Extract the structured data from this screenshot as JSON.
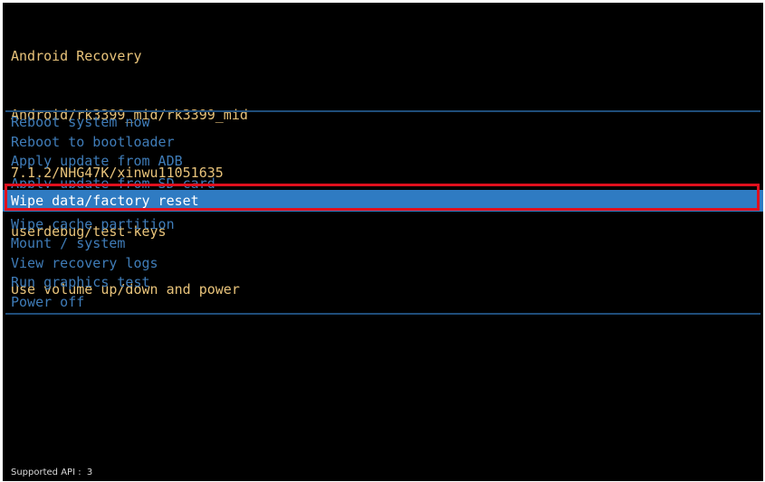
{
  "header": {
    "title": "Android Recovery",
    "device": "Android/rk3399_mid/rk3399_mid",
    "build": "7.1.2/NHG47K/xinwu11051635",
    "build_type": "userdebug/test-keys",
    "instructions": "Use volume up/down and power"
  },
  "menu": {
    "items": [
      {
        "label": "Reboot system now"
      },
      {
        "label": "Reboot to bootloader"
      },
      {
        "label": "Apply update from ADB"
      },
      {
        "label": "Apply update from SD card"
      },
      {
        "label": "Wipe data/factory reset"
      },
      {
        "label": "Wipe cache partition"
      },
      {
        "label": "Mount / system"
      },
      {
        "label": "View recovery logs"
      },
      {
        "label": "Run graphics test"
      },
      {
        "label": "Power off"
      }
    ],
    "selected_label": "Wipe data/factory reset"
  },
  "footer": {
    "api_text": "Supported API :  3"
  },
  "colors": {
    "background": "#000000",
    "header_text": "#e8c37a",
    "menu_text": "#3f7cb8",
    "selected_bg": "#2f7bc2",
    "selected_text": "#ffffff",
    "highlight_border": "#e0101e"
  }
}
